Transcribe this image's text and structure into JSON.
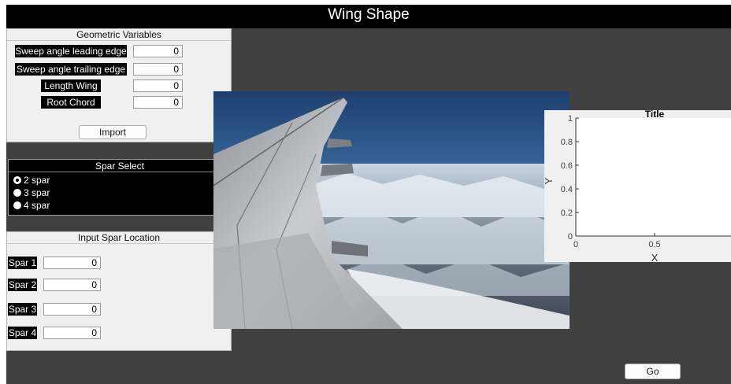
{
  "window": {
    "title": "Wing Shape"
  },
  "geometric": {
    "title": "Geometric Variables",
    "fields": [
      {
        "label": "Sweep angle leading edge",
        "value": "0"
      },
      {
        "label": "Sweep angle trailing edge",
        "value": "0"
      },
      {
        "label": "Length Wing",
        "value": "0"
      },
      {
        "label": "Root Chord",
        "value": "0"
      }
    ],
    "import_label": "Import"
  },
  "spar_select": {
    "title": "Spar Select",
    "options": [
      "2 spar",
      "3 spar",
      "4 spar"
    ],
    "selected": "2 spar"
  },
  "spar_location": {
    "title": "Input Spar Location",
    "fields": [
      {
        "label": "Spar 1",
        "value": "0"
      },
      {
        "label": "Spar 2",
        "value": "0"
      },
      {
        "label": "Spar 3",
        "value": "0"
      },
      {
        "label": "Spar 4",
        "value": "0"
      }
    ]
  },
  "go_label": "Go",
  "chart_data": {
    "type": "line",
    "title": "Title",
    "xlabel": "X",
    "ylabel": "Y",
    "xlim": [
      0,
      1
    ],
    "ylim": [
      0,
      1
    ],
    "xticks": [
      "0",
      "0.5"
    ],
    "yticks": [
      "0",
      "0.2",
      "0.4",
      "0.6",
      "0.8",
      "1"
    ],
    "series": [],
    "grid": false
  }
}
